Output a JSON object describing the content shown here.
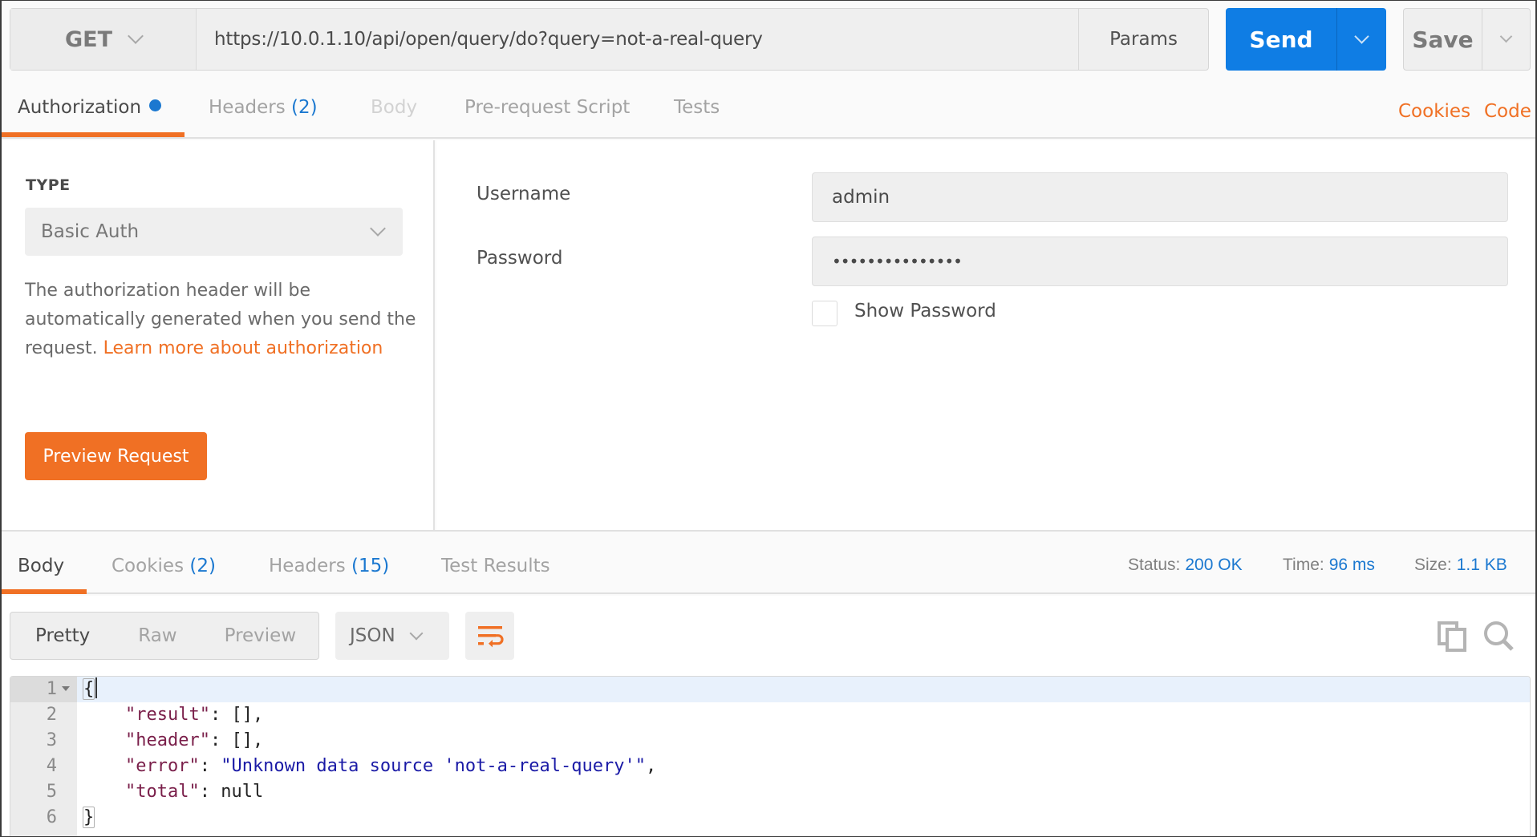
{
  "request": {
    "method": "GET",
    "url": "https://10.0.1.10/api/open/query/do?query=not-a-real-query",
    "params_label": "Params",
    "send_label": "Send",
    "save_label": "Save"
  },
  "request_tabs": {
    "authorization": "Authorization",
    "headers": "Headers",
    "headers_count": "(2)",
    "body": "Body",
    "prerequest": "Pre-request Script",
    "tests": "Tests",
    "cookies_link": "Cookies",
    "code_link": "Code"
  },
  "auth": {
    "type_label": "TYPE",
    "type_value": "Basic Auth",
    "description": "The authorization header will be automatically generated when you send the request. ",
    "learn_more": "Learn more about authorization",
    "preview_button": "Preview Request",
    "username_label": "Username",
    "username_value": "admin",
    "password_label": "Password",
    "password_value": "•••••••••••••••",
    "show_password_label": "Show Password",
    "show_password_checked": false
  },
  "response_tabs": {
    "body": "Body",
    "cookies": "Cookies",
    "cookies_count": "(2)",
    "headers": "Headers",
    "headers_count": "(15)",
    "test_results": "Test Results"
  },
  "response_meta": {
    "status_label": "Status:",
    "status_value": "200 OK",
    "time_label": "Time:",
    "time_value": "96 ms",
    "size_label": "Size:",
    "size_value": "1.1 KB"
  },
  "response_view": {
    "pretty": "Pretty",
    "raw": "Raw",
    "preview": "Preview",
    "format": "JSON"
  },
  "colors": {
    "accent_orange": "#f07024",
    "accent_blue": "#0f7de4",
    "count_blue": "#1b78d0"
  },
  "code": {
    "line_numbers": [
      "1",
      "2",
      "3",
      "4",
      "5",
      "6"
    ],
    "open_brace": "{",
    "close_brace": "}",
    "indent": "    ",
    "lines": [
      {
        "key": "\"result\"",
        "sep": ": ",
        "value": "[]",
        "value_type": "punct",
        "trail": ","
      },
      {
        "key": "\"header\"",
        "sep": ": ",
        "value": "[]",
        "value_type": "punct",
        "trail": ","
      },
      {
        "key": "\"error\"",
        "sep": ": ",
        "value": "\"Unknown data source 'not-a-real-query'\"",
        "value_type": "string",
        "trail": ","
      },
      {
        "key": "\"total\"",
        "sep": ": ",
        "value": "null",
        "value_type": "punct",
        "trail": ""
      }
    ]
  }
}
